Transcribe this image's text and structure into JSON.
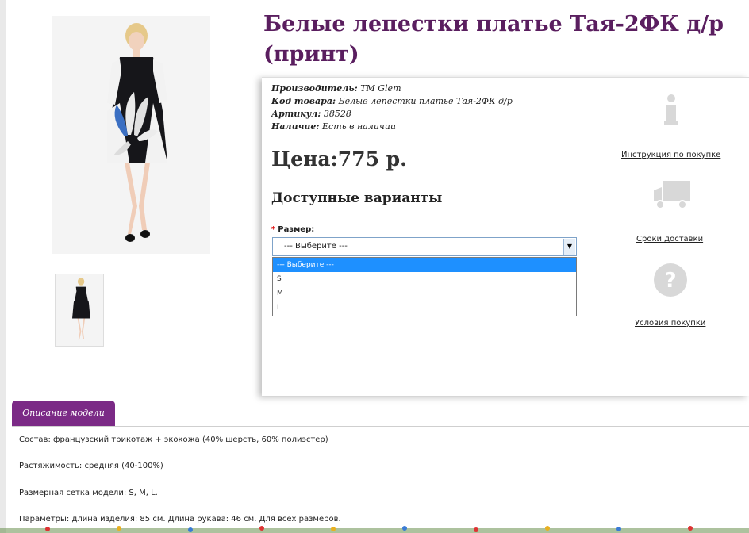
{
  "product": {
    "title": "Белые лепестки платье Тая-2ФК д/р (принт)",
    "manufacturer_label": "Производитель:",
    "manufacturer": "TM Glem",
    "code_label": "Код товара:",
    "code": "Белые лепестки платье Тая-2ФК д/р",
    "article_label": "Артикул:",
    "article": "38528",
    "availability_label": "Наличие:",
    "availability": "Есть в наличии",
    "price": "Цена:775 р."
  },
  "options": {
    "heading": "Доступные варианты",
    "size_required_mark": "*",
    "size_label": "Размер:",
    "selected": "--- Выберите ---",
    "items": [
      "--- Выберите ---",
      "S",
      "M",
      "L"
    ]
  },
  "side": {
    "instruction": "Инструкция по покупке",
    "delivery": "Сроки доставки",
    "conditions": "Условия покупки"
  },
  "description": {
    "tab": "Описание модели",
    "rows": [
      {
        "label": "Состав:",
        "value": " французский трикотаж + экокожа (40% шерсть, 60% полиэстер)"
      },
      {
        "label": "Растяжимость:",
        "value": " средняя (40-100%)"
      },
      {
        "label": "Размерная сетка модели:",
        "value": " S, M, L."
      },
      {
        "label": "Параметры:",
        "value": " длина изделия: 85 см. Длина рукава: 46 см. Для всех размеров."
      }
    ]
  },
  "colors": {
    "title": "#5a1e5f",
    "tab": "#7b2a86",
    "selected_option": "#1e90ff"
  }
}
